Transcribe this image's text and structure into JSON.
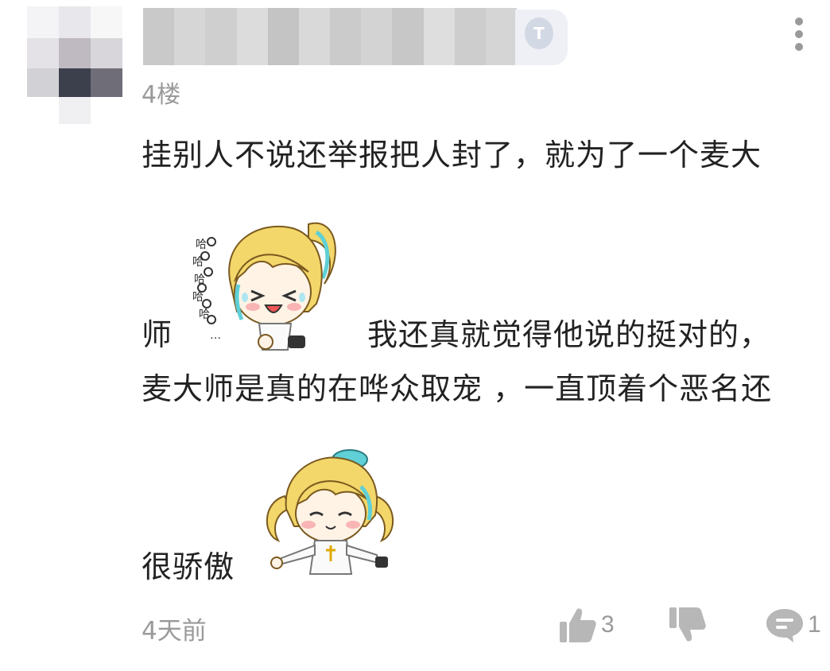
{
  "comment": {
    "floor": "4楼",
    "text": {
      "line1": "挂别人不说还举报把人封了，就为了一个麦大",
      "line2_before_sticker": "师",
      "line2_after_sticker": "我还真就觉得他说的挺对的，",
      "line3": "麦大师是真的在哗众取宠 ，一直顶着个恶名还",
      "line4": "很骄傲"
    },
    "stickers": [
      {
        "name": "laughing-character-sticker",
        "lettering": "哈哈哈哈哈..."
      },
      {
        "name": "smiling-character-sticker"
      }
    ],
    "time": "4天前",
    "likes": "3",
    "replies": "1"
  },
  "icons": {
    "more": "vertical-dots-icon",
    "like": "thumbs-up-icon",
    "dislike": "thumbs-down-icon",
    "reply": "comment-bubble-icon"
  },
  "colors": {
    "text": "#222222",
    "meta": "#9a9a9a",
    "background": "#ffffff",
    "hair": "#f3d76a",
    "hair_accent": "#5fd0d6"
  }
}
